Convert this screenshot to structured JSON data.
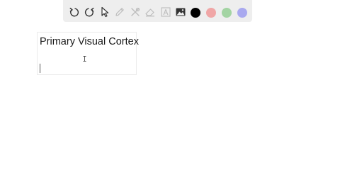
{
  "toolbar": {
    "tools": [
      {
        "name": "undo-icon"
      },
      {
        "name": "redo-icon"
      },
      {
        "name": "select-pointer-icon"
      },
      {
        "name": "pen-icon"
      },
      {
        "name": "tools-icon"
      },
      {
        "name": "eraser-icon"
      },
      {
        "name": "text-icon"
      },
      {
        "name": "image-icon"
      }
    ],
    "colors": [
      {
        "name": "black",
        "hex": "#000000"
      },
      {
        "name": "red",
        "hex": "#f0a6a6"
      },
      {
        "name": "green",
        "hex": "#a3d4a3"
      },
      {
        "name": "purple",
        "hex": "#a9a9ef"
      }
    ]
  },
  "textbox": {
    "title": "Primary Visual Cortex"
  }
}
